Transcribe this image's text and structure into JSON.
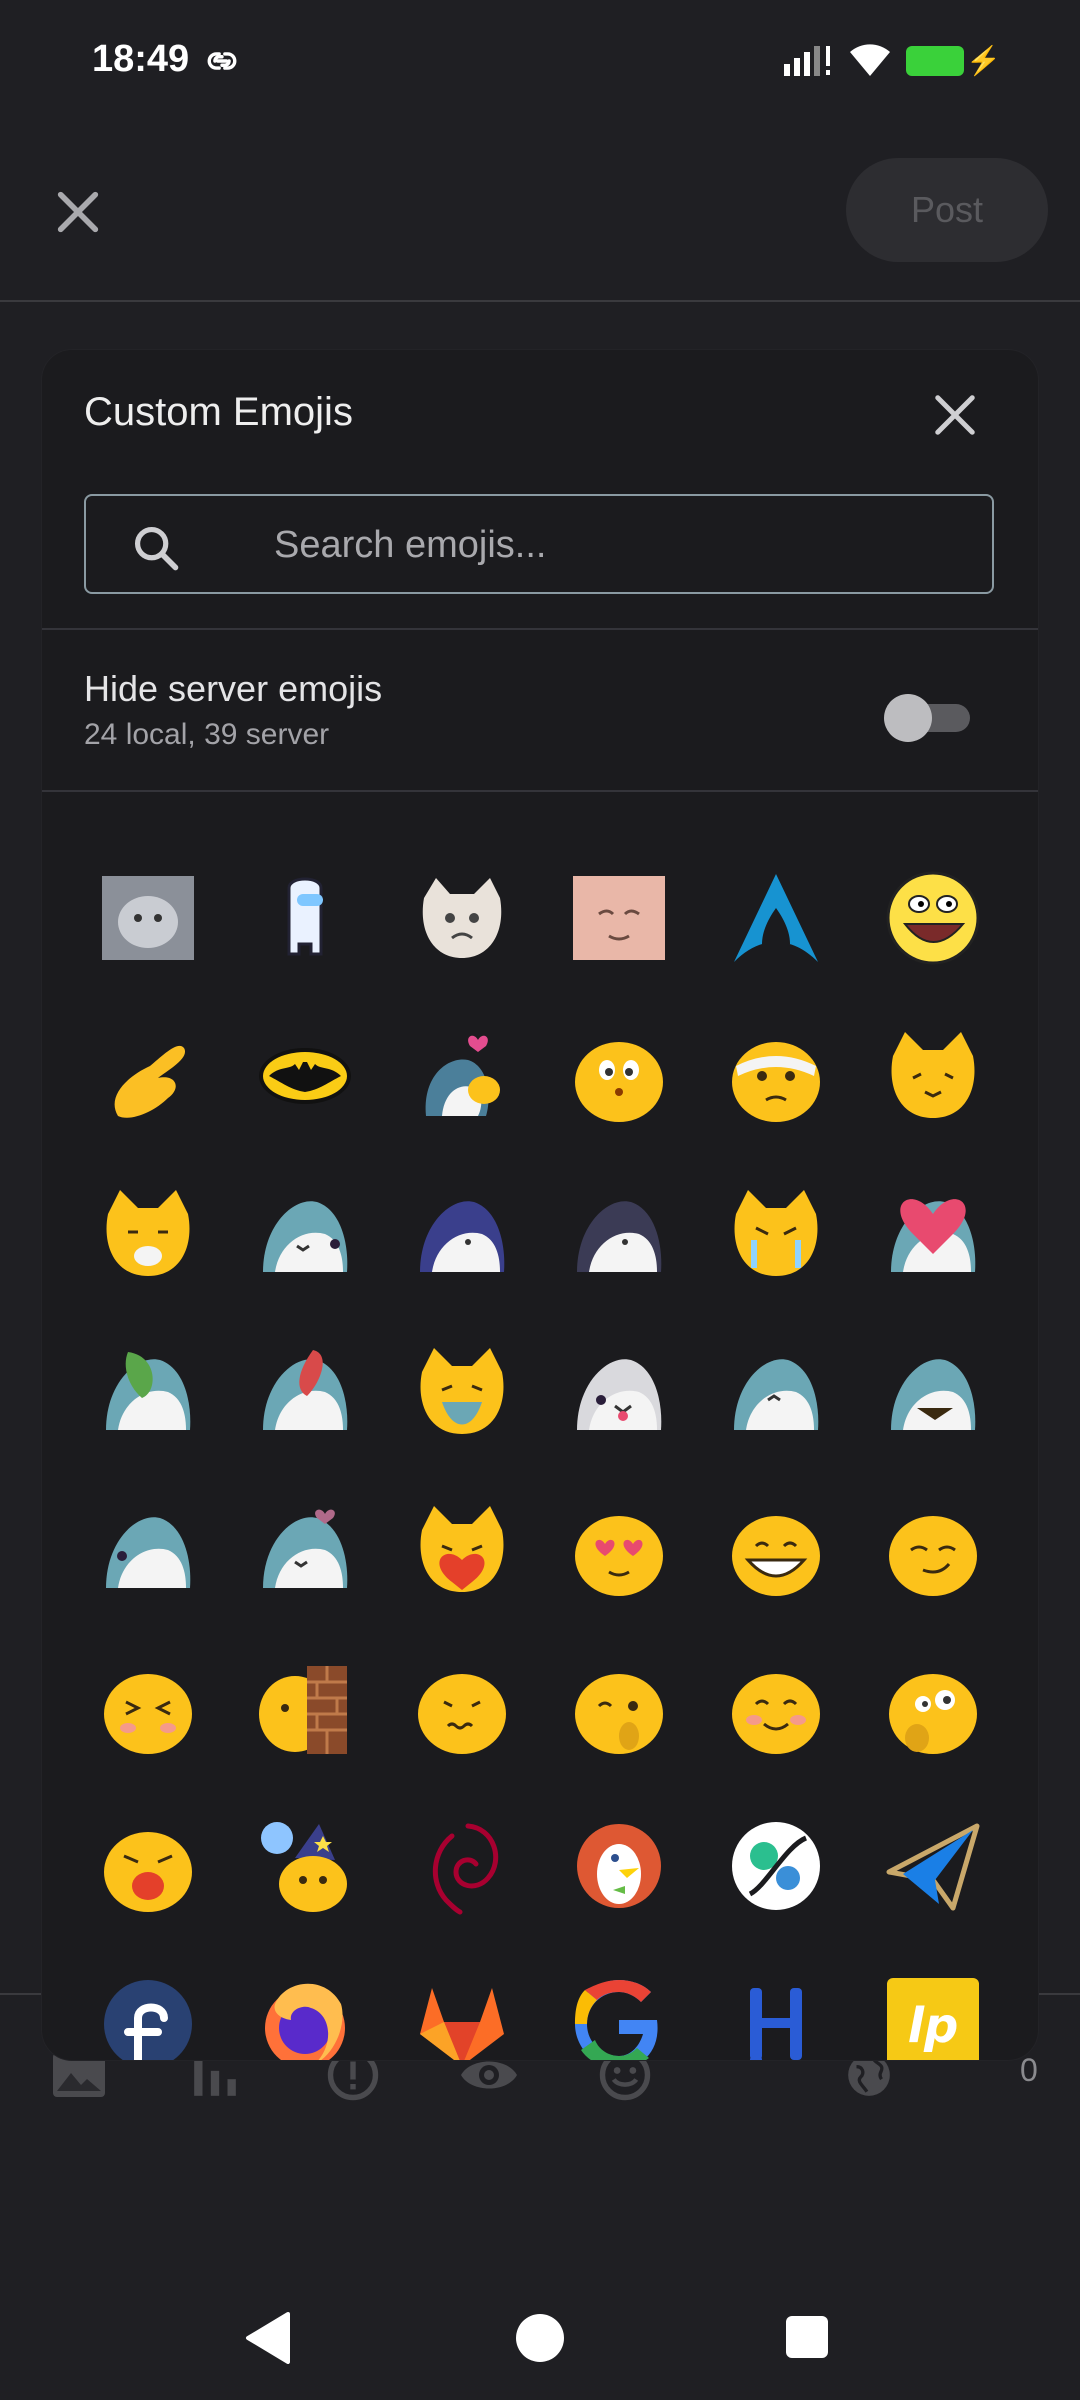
{
  "status_bar": {
    "time": "18:49"
  },
  "header": {
    "post_label": "Post"
  },
  "dialog": {
    "title": "Custom Emojis",
    "search_placeholder": "Search emojis...",
    "hide_server_label": "Hide server emojis",
    "counts": "24 local, 39 server",
    "hide_server_enabled": false
  },
  "toolbar": {
    "char_count": "0"
  },
  "emojis": [
    "cat-photo",
    "among-us-crewmate",
    "crying-cat",
    "pink-blob-face",
    "arch-linux-logo",
    "epic-face",
    "pinching-hand",
    "batman-logo",
    "blob-bird-hearts",
    "blob-shy",
    "blob-bandaged",
    "blob-cat",
    "blob-cat-eating",
    "blob-shark",
    "blob-shark-hooded-blue",
    "blob-shark-hooded-dark",
    "blob-cat-crying",
    "blob-shark-heart",
    "blob-shark-leaf",
    "blob-shark-sausage",
    "blob-cat-fish",
    "blob-shark-tongue",
    "blob-shark-happy",
    "blob-shark-grin",
    "blob-shark-side",
    "blob-shark-love",
    "blob-cat-heart",
    "blob-heart-eyes",
    "blob-grin",
    "blob-smirk",
    "blob-laugh",
    "blob-wall",
    "blob-nervous",
    "blob-wink-think",
    "blob-blush",
    "blob-thinking",
    "blob-yawn",
    "blob-wizard",
    "debian-logo",
    "duckduckgo-logo",
    "mastodon-client-logo",
    "paper-plane",
    "fedora-logo",
    "firefox-logo",
    "gitlab-logo",
    "google-logo",
    "hydrogen-logo",
    "liberapay-logo"
  ],
  "colors": {
    "background": "#1f1f23",
    "dialog": "#1b1b1e",
    "blob": "#fcc21b",
    "shark": "#6ba7b5"
  }
}
